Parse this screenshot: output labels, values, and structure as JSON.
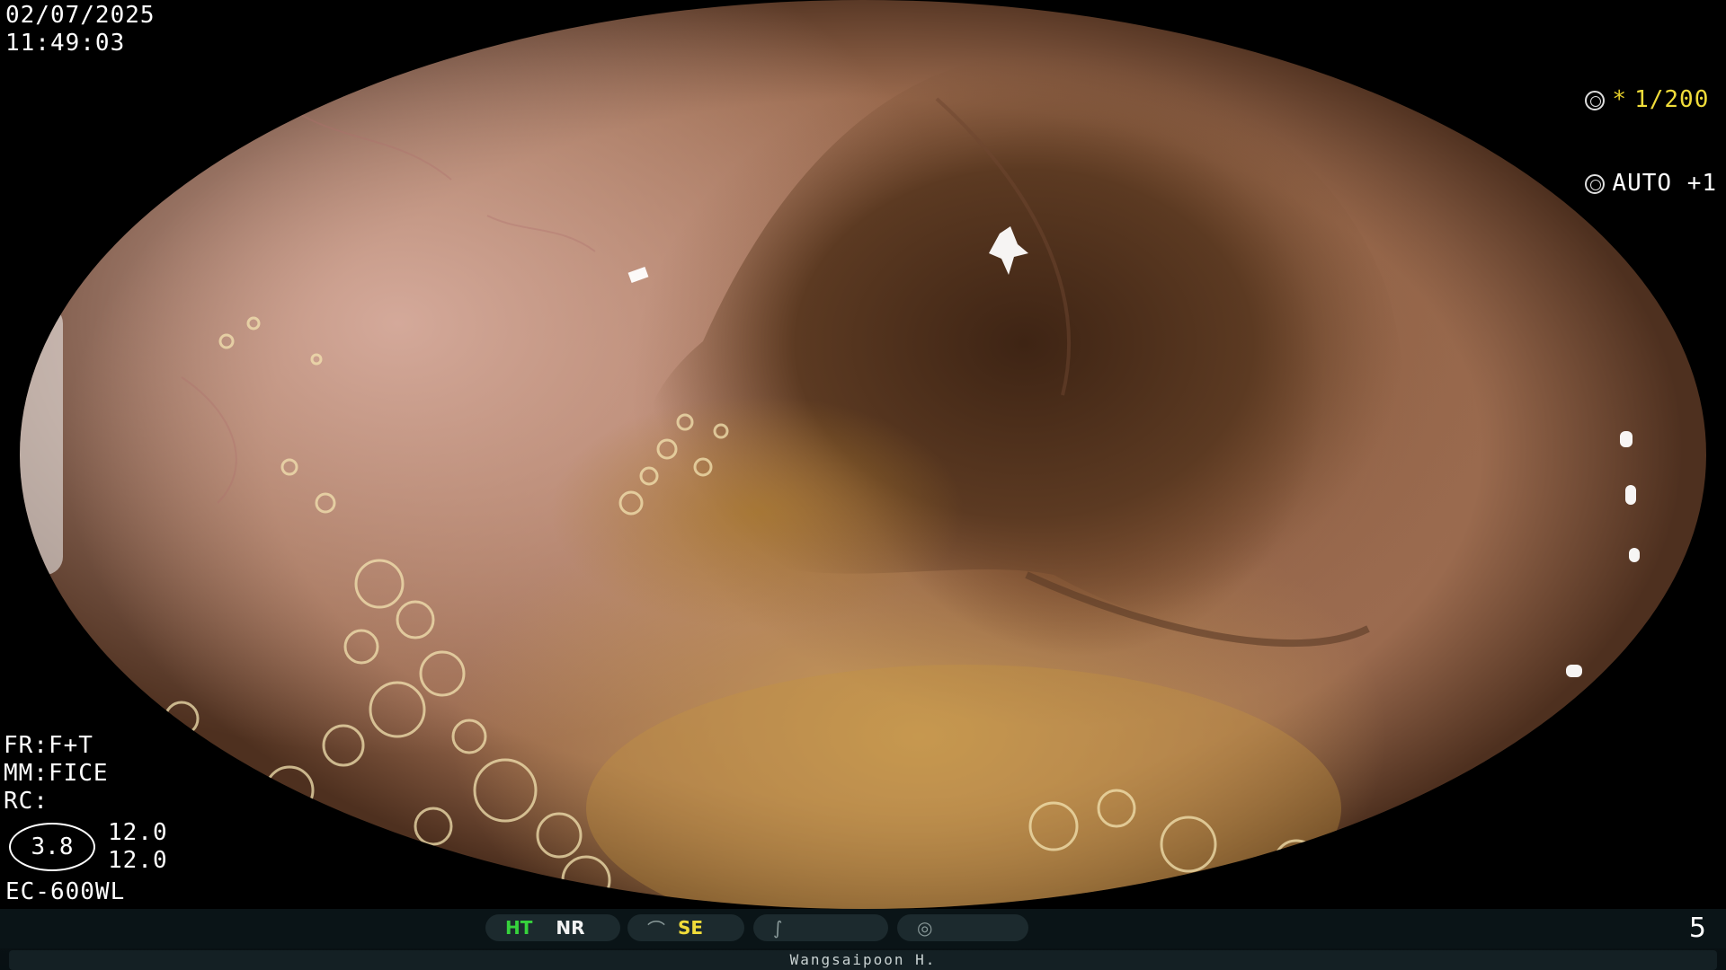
{
  "osd": {
    "date": "02/07/2025",
    "time": "11:49:03",
    "shutter": "1/200",
    "shutter_marker": "*",
    "iris": "AUTO +1",
    "fr": "FR:F+T",
    "mm": "MM:FICE",
    "rc": "RC:",
    "zoom": "3.8",
    "gain_1": "12.0",
    "gain_2": "12.0",
    "scope_model": "EC-600WL"
  },
  "status_bar": {
    "ht": "HT",
    "nr": "NR",
    "se": "SE",
    "page_number": "5",
    "operator": "Wangsaipoon H."
  },
  "colors": {
    "highlight_green": "#36d23c",
    "highlight_yellow": "#f0dc3a",
    "background": "#000000"
  },
  "icons": [
    "structure-enhance-icon",
    "color-mode-icon",
    "iris-icon",
    "shutter-icon"
  ]
}
